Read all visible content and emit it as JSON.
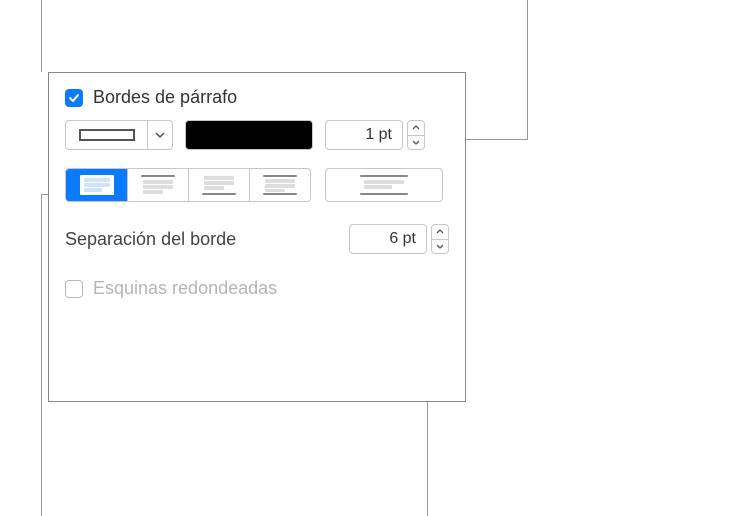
{
  "header": {
    "checkbox_checked": true,
    "title": "Bordes de párrafo"
  },
  "border": {
    "style": "solid-outline",
    "color": "#000000",
    "width_value": "1 pt"
  },
  "positions": {
    "options": [
      "all",
      "top",
      "bottom",
      "left",
      "outside"
    ],
    "active": "all"
  },
  "separation": {
    "label": "Separación del borde",
    "value": "6 pt"
  },
  "rounded": {
    "checked": false,
    "label": "Esquinas redondeadas"
  }
}
